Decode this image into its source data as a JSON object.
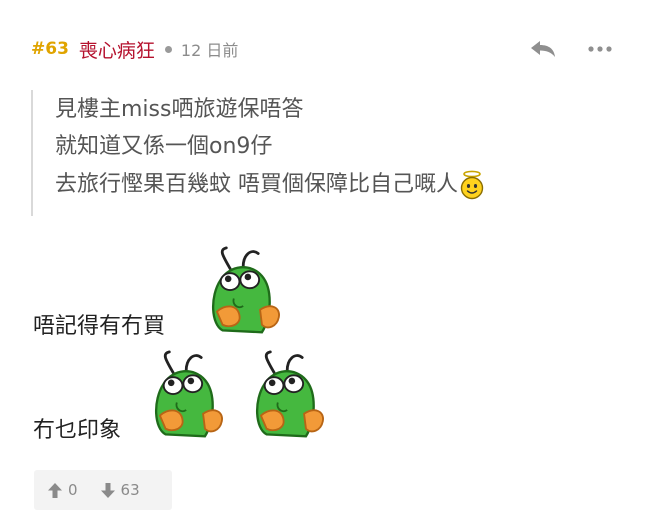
{
  "post": {
    "number": "#63",
    "username": "喪心病狂",
    "time": "12 日前"
  },
  "quote": {
    "lines": [
      "見樓主miss哂旅遊保唔答",
      "就知道又係一個on9仔",
      "去旅行慳果百幾蚊 唔買個保障比自己嘅人"
    ]
  },
  "body": {
    "lines": [
      "唔記得有冇買",
      "冇乜印象"
    ]
  },
  "votes": {
    "up": "0",
    "down": "63"
  },
  "colors": {
    "post_number": "#e0a400",
    "username": "#b5122e",
    "sticker_green": "#45b83f",
    "sticker_hand": "#f29a38"
  },
  "icons": {
    "reply": "reply-icon",
    "more": "more-icon",
    "upvote": "arrow-up-icon",
    "downvote": "arrow-down-icon",
    "angel": "angel-emoji-icon",
    "sticker": "thinking-bug-sticker"
  }
}
